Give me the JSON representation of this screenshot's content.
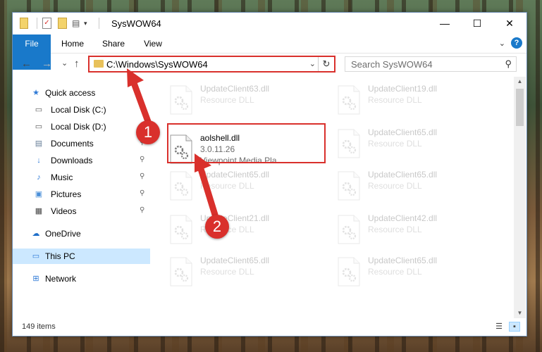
{
  "window": {
    "title": "SysWOW64",
    "minimize": "—",
    "maximize": "☐",
    "close": "✕"
  },
  "ribbon": {
    "tabs": [
      "File",
      "Home",
      "Share",
      "View"
    ],
    "collapse_icon": "chevron-down-icon",
    "help_label": "?"
  },
  "nav": {
    "back": "←",
    "forward": "→",
    "recent": "⌄",
    "up": "↑",
    "address": "C:\\Windows\\SysWOW64",
    "address_dropdown": "⌄",
    "refresh": "↻",
    "search_placeholder": "Search SysWOW64",
    "search_icon": "⚲"
  },
  "sidebar": {
    "items": [
      {
        "label": "Quick access",
        "icon": "star-icon",
        "glyph": "★",
        "color": "#2f7ad6",
        "pinned": false,
        "indent": 0
      },
      {
        "label": "Local Disk (C:)",
        "icon": "drive-icon",
        "glyph": "▭",
        "color": "#555555",
        "pinned": false,
        "indent": 1
      },
      {
        "label": "Local Disk (D:)",
        "icon": "drive-icon",
        "glyph": "▭",
        "color": "#555555",
        "pinned": false,
        "indent": 1
      },
      {
        "label": "Documents",
        "icon": "documents-icon",
        "glyph": "▤",
        "color": "#6a7f99",
        "pinned": true,
        "indent": 1
      },
      {
        "label": "Downloads",
        "icon": "download-icon",
        "glyph": "↓",
        "color": "#2f7ad6",
        "pinned": true,
        "indent": 1
      },
      {
        "label": "Music",
        "icon": "music-icon",
        "glyph": "♪",
        "color": "#2f7ad6",
        "pinned": true,
        "indent": 1
      },
      {
        "label": "Pictures",
        "icon": "pictures-icon",
        "glyph": "▣",
        "color": "#4a8fd8",
        "pinned": true,
        "indent": 1
      },
      {
        "label": "Videos",
        "icon": "videos-icon",
        "glyph": "▦",
        "color": "#444444",
        "pinned": true,
        "indent": 1
      },
      {
        "label": "OneDrive",
        "icon": "cloud-icon",
        "glyph": "☁",
        "color": "#1f6fc9",
        "pinned": false,
        "indent": 0
      },
      {
        "label": "This PC",
        "icon": "computer-icon",
        "glyph": "▭",
        "color": "#2f7ad6",
        "pinned": false,
        "indent": 0
      },
      {
        "label": "Network",
        "icon": "network-icon",
        "glyph": "⊞",
        "color": "#2f7ad6",
        "pinned": false,
        "indent": 0
      }
    ],
    "pin_glyph": "📌"
  },
  "files": [
    {
      "name": "UpdateClient63.dll",
      "sub1": "Resource DLL",
      "sub2": "",
      "faded": true
    },
    {
      "name": "UpdateClient19.dll",
      "sub1": "Resource DLL",
      "sub2": "",
      "faded": true
    },
    {
      "name": "aolshell.dll",
      "sub1": "3.0.11.26",
      "sub2": "Viewpoint Media Pla...",
      "faded": false
    },
    {
      "name": "UpdateClient65.dll",
      "sub1": "Resource DLL",
      "sub2": "",
      "faded": true
    },
    {
      "name": "UpdateClient65.dll",
      "sub1": "Resource DLL",
      "sub2": "",
      "faded": true
    },
    {
      "name": "UpdateClient65.dll",
      "sub1": "Resource DLL",
      "sub2": "",
      "faded": true
    },
    {
      "name": "UpdateClient21.dll",
      "sub1": "Resource DLL",
      "sub2": "",
      "faded": true
    },
    {
      "name": "UpdateClient42.dll",
      "sub1": "Resource DLL",
      "sub2": "",
      "faded": true
    },
    {
      "name": "UpdateClient65.dll",
      "sub1": "Resource DLL",
      "sub2": "",
      "faded": true
    },
    {
      "name": "UpdateClient65.dll",
      "sub1": "Resource DLL",
      "sub2": "",
      "faded": true
    }
  ],
  "status": {
    "items_count": "149 items"
  },
  "annotations": {
    "step1": "1",
    "step2": "2",
    "color": "#d9302c"
  }
}
